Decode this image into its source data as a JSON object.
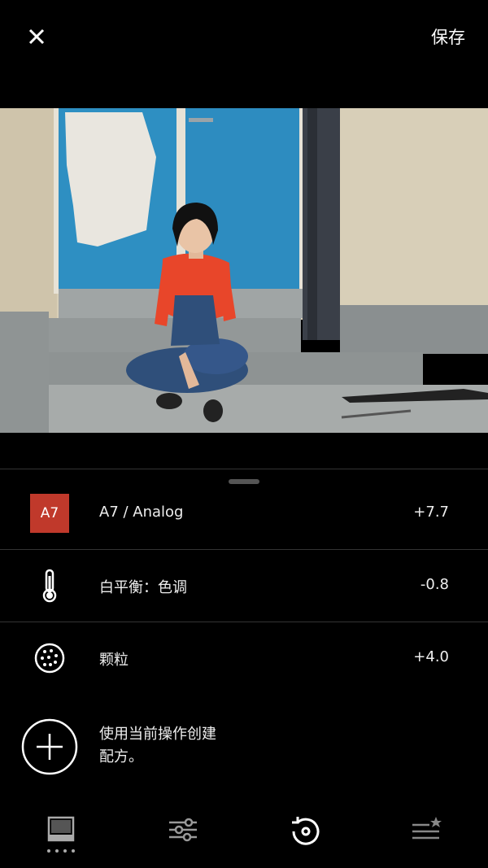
{
  "topbar": {
    "save_label": "保存"
  },
  "adjustments": [
    {
      "badge": "A7",
      "label": "A7 / Analog",
      "value": "+7.7",
      "badge_color": "#c0392b"
    },
    {
      "label": "白平衡：色调",
      "value": "-0.8",
      "icon": "thermometer-icon"
    },
    {
      "label": "颗粒",
      "value": "+4.0",
      "icon": "grain-icon"
    }
  ],
  "recipe": {
    "line1": "使用当前操作创建",
    "line2": "配方。"
  },
  "tabs": [
    {
      "icon": "presets-icon",
      "active": true
    },
    {
      "icon": "sliders-icon"
    },
    {
      "icon": "history-icon"
    },
    {
      "icon": "recipes-icon"
    }
  ]
}
